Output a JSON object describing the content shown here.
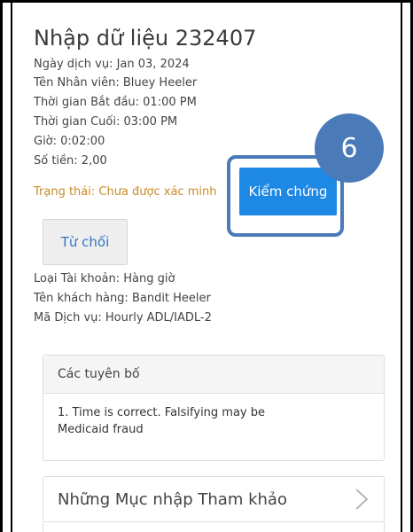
{
  "entry": {
    "title": "Nhập dữ liệu 232407",
    "service_date": "Ngày dịch vụ: Jan 03, 2024",
    "employee_name": "Tên Nhân viên: Bluey Heeler",
    "start_time": "Thời gian Bắt đầu: 01:00 PM",
    "end_time": "Thời gian Cuối: 03:00 PM",
    "hours": "Giờ: 0:02:00",
    "amount": "Số tiền: 2,00",
    "status": "Trạng thái: Chưa được xác minh"
  },
  "actions": {
    "verify_label": "Kiểm chứng",
    "reject_label": "Từ chối",
    "step_number": "6"
  },
  "details": {
    "account_type": "Loại Tài khoản: Hàng giờ",
    "client_name": "Tên khách hàng: Bandit Heeler",
    "service_code": "Mã Dịch vụ: Hourly ADL/IADL-2"
  },
  "statements": {
    "header": "Các tuyên bố",
    "text": "1. Time is correct. Falsifying may be Medicaid fraud"
  },
  "references": {
    "label": "Những Mục nhập Tham khảo",
    "chevron_icon": "chevron-right-icon"
  },
  "colors": {
    "accent": "#1e88e5",
    "status_orange": "#c98a2a",
    "highlight_blue": "#4a7ab8",
    "link_blue": "#2e74c8"
  }
}
